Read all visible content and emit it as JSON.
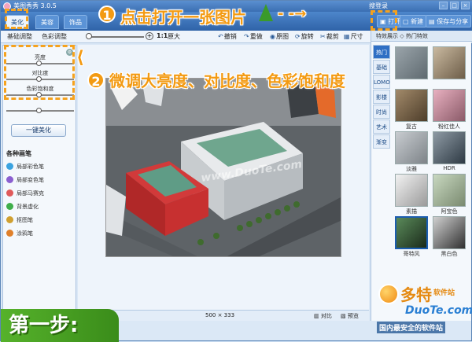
{
  "window": {
    "title": "美图秀秀 3.0.5",
    "login": "搜登录"
  },
  "main_tabs": [
    {
      "label": "美化"
    },
    {
      "label": "美容"
    },
    {
      "label": "饰品"
    }
  ],
  "top_actions": {
    "open": "打开",
    "new": "新建",
    "save_share": "保存与分享"
  },
  "toolbar": {
    "sub_tab_basic": "基础调整",
    "sub_tab_color": "色彩调整",
    "zoom_ratio": "1:1",
    "original_size": "原大",
    "undo": "撤销",
    "redo": "重做",
    "original": "原图",
    "rotate": "旋转",
    "crop": "裁剪",
    "resize": "尺寸"
  },
  "left_panel": {
    "adjustments": [
      {
        "label": "亮度"
      },
      {
        "label": "对比度"
      },
      {
        "label": "色彩饱和度"
      }
    ],
    "one_key": "一键美化",
    "brushes_title": "各种画笔",
    "brushes": [
      {
        "label": "局部彩色笔",
        "color": "#3aa3e0"
      },
      {
        "label": "局部变色笔",
        "color": "#8b5fd0"
      },
      {
        "label": "局部马赛克",
        "color": "#e05a5a"
      },
      {
        "label": "背景虚化",
        "color": "#3fae4a"
      },
      {
        "label": "抠图笔",
        "color": "#d0a030"
      },
      {
        "label": "涂鸦笔",
        "color": "#e0802a"
      }
    ]
  },
  "status": {
    "dimensions": "500 × 333",
    "compare": "对比",
    "preview": "预览"
  },
  "right_panel": {
    "header": "特效展示 ◇ 热门特效",
    "side_tabs": [
      {
        "label": "热门"
      },
      {
        "label": "基础"
      },
      {
        "label": "LOMO"
      },
      {
        "label": "影楼"
      },
      {
        "label": "时尚"
      },
      {
        "label": "艺术"
      },
      {
        "label": "渐变"
      }
    ],
    "effects": [
      {
        "label": ""
      },
      {
        "label": ""
      },
      {
        "label": "复古"
      },
      {
        "label": "粉红佳人"
      },
      {
        "label": "淡雅"
      },
      {
        "label": "HDR"
      },
      {
        "label": "素描"
      },
      {
        "label": "阿宝色"
      },
      {
        "label": "哥特风"
      },
      {
        "label": "黑白色"
      }
    ]
  },
  "overlay": {
    "step1_num": "1",
    "step1_text": "点击打开一张图片",
    "step2_num": "2",
    "step2_text": "微调大亮度、对比度、色彩饱和度",
    "step_banner": "第一步:"
  },
  "watermark": {
    "name": "多特",
    "sub": "软件站",
    "url": "DuoTe.com",
    "slogan": "国内最安全的软件站",
    "photo_mark": "www.DuoTe.com"
  }
}
